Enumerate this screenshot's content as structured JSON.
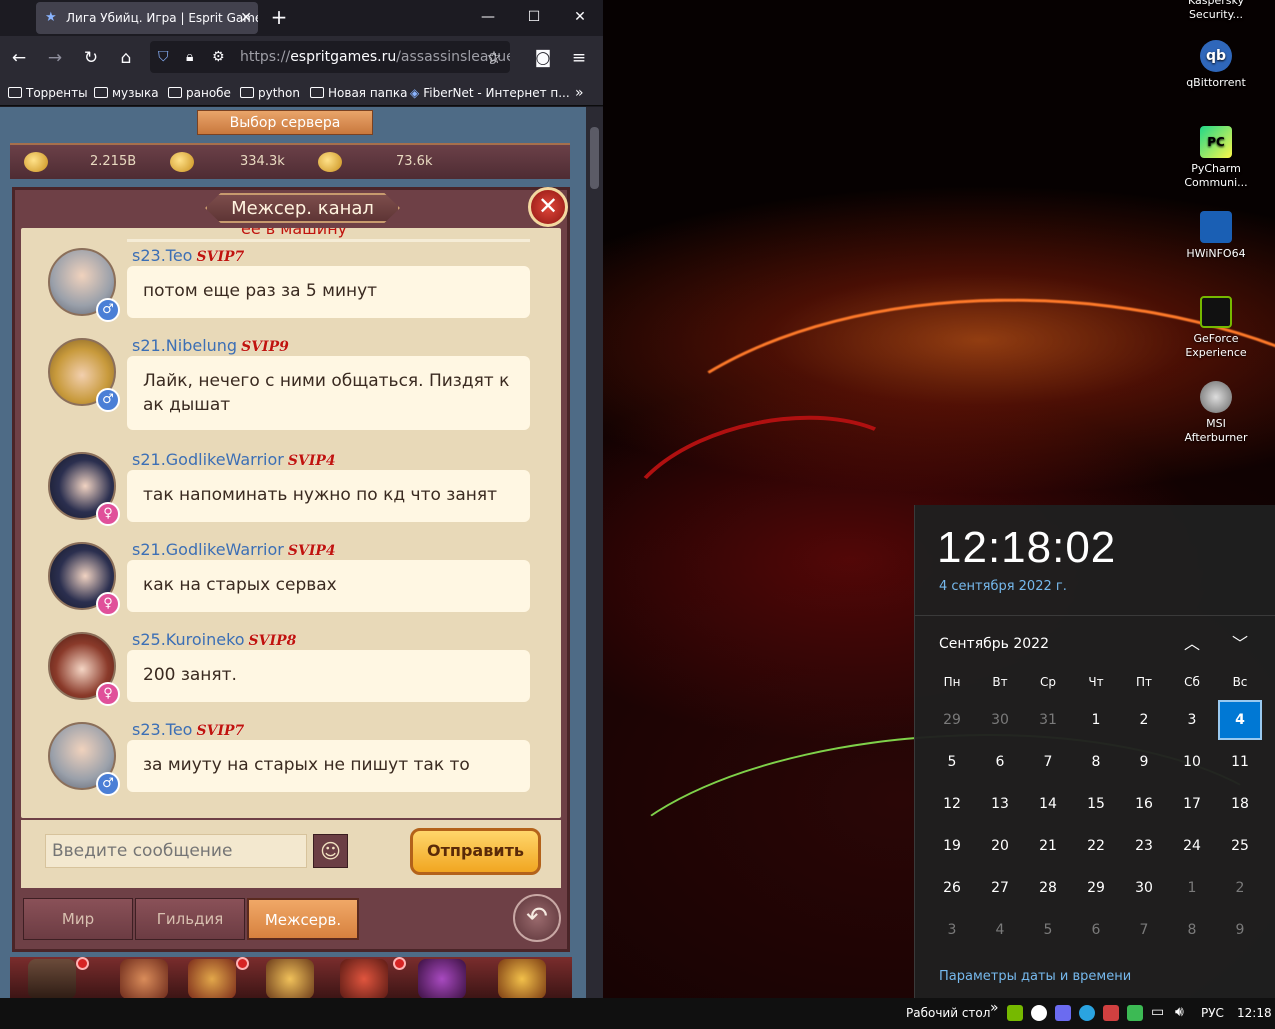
{
  "browser": {
    "tab_title": "Лига Убийц. Игра | Esprit Games",
    "url_scheme": "https://",
    "url_host": "espritgames.ru",
    "url_path": "/assassinsleague/",
    "bookmarks": [
      "Торренты",
      "музыка",
      "ранобе",
      "python",
      "Новая папка",
      "FiberNet - Интернет п..."
    ]
  },
  "game": {
    "server_button": "Выбор сервера",
    "resources": [
      "2.215B",
      "334.3k",
      "73.6k"
    ],
    "channel_title": "Межсер. канал",
    "top_cut_text": "ее в машину",
    "messages": [
      {
        "user": "s23.Teo",
        "vip": "SVIP7",
        "gender": "♂",
        "text": "потом еще раз за 5 минут"
      },
      {
        "user": "s21.Nibelung",
        "vip": "SVIP9",
        "gender": "♂",
        "text": "Лайк, нечего с ними общаться. Пиздят к ак дышат"
      },
      {
        "user": "s21.GodlikeWarrior",
        "vip": "SVIP4",
        "gender": "♀",
        "text": "так напоминать нужно по кд что занят"
      },
      {
        "user": "s21.GodlikeWarrior",
        "vip": "SVIP4",
        "gender": "♀",
        "text": "как на старых сервах"
      },
      {
        "user": "s25.Kuroineko",
        "vip": "SVIP8",
        "gender": "♀",
        "text": "200 занят."
      },
      {
        "user": "s23.Teo",
        "vip": "SVIP7",
        "gender": "♂",
        "text": "за миуту на старых не пишут так то"
      }
    ],
    "input_placeholder": "Введите сообщение",
    "send_button": "Отправить",
    "tabs": [
      "Мир",
      "Гильдия",
      "Межсерв."
    ],
    "active_tab": "Межсерв."
  },
  "desktop": {
    "icons": [
      "Kaspersky Security...",
      "qBittorrent",
      "PyCharm Communi...",
      "HWiNFO64",
      "GeForce Experience",
      "MSI Afterburner"
    ],
    "icon_colors": [
      "#c8102e",
      "#2f67ba",
      "#21d789",
      "#1a5fb4",
      "#76b900",
      "#c0c0c0"
    ]
  },
  "clock": {
    "time": "12:18:02",
    "date_full": "4 сентября 2022 г.",
    "month_year": "Сентябрь 2022",
    "weekdays": [
      "Пн",
      "Вт",
      "Ср",
      "Чт",
      "Пт",
      "Сб",
      "Вс"
    ],
    "weeks": [
      [
        "29",
        "30",
        "31",
        "1",
        "2",
        "3",
        "4"
      ],
      [
        "5",
        "6",
        "7",
        "8",
        "9",
        "10",
        "11"
      ],
      [
        "12",
        "13",
        "14",
        "15",
        "16",
        "17",
        "18"
      ],
      [
        "19",
        "20",
        "21",
        "22",
        "23",
        "24",
        "25"
      ],
      [
        "26",
        "27",
        "28",
        "29",
        "30",
        "1",
        "2"
      ],
      [
        "3",
        "4",
        "5",
        "6",
        "7",
        "8",
        "9"
      ]
    ],
    "today": "4",
    "settings_link": "Параметры даты и времени"
  },
  "taskbar": {
    "desktop_label": "Рабочий стол",
    "chevron": "»",
    "language": "РУС",
    "clock": "12:18",
    "tray_colors": [
      "#76b900",
      "#ffffff",
      "#6b6bf0",
      "#2aa3e0",
      "#d04040",
      "#3cba54"
    ]
  }
}
